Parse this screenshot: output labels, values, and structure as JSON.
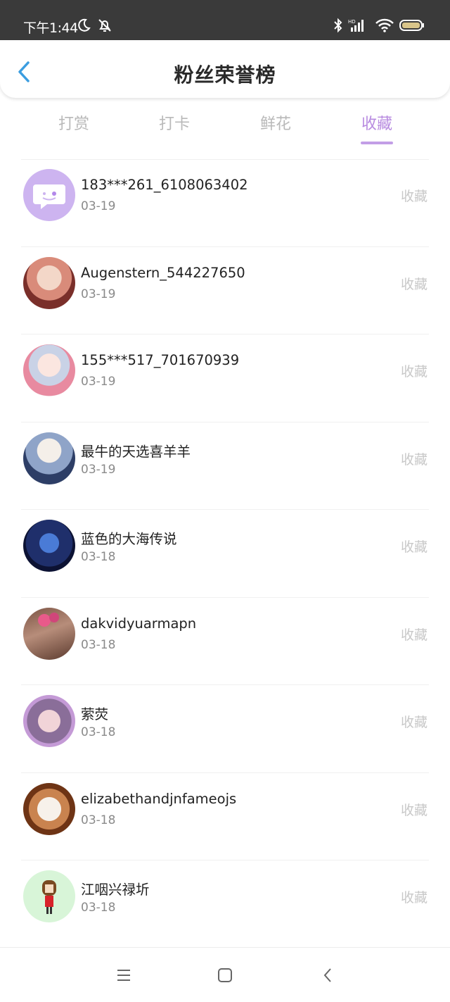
{
  "status_bar": {
    "time": "下午1:44",
    "icons": [
      "moon-icon",
      "bell-off-icon",
      "bluetooth-icon",
      "hd-signal-icon",
      "wifi-icon",
      "battery-icon"
    ]
  },
  "header": {
    "title": "粉丝荣誉榜",
    "back_icon": "chevron-left-icon"
  },
  "tabs": [
    {
      "label": "打赏",
      "active": false
    },
    {
      "label": "打卡",
      "active": false
    },
    {
      "label": "鲜花",
      "active": false
    },
    {
      "label": "收藏",
      "active": true
    }
  ],
  "fans": [
    {
      "name": "183***261_6108063402",
      "date": "03-19",
      "action": "收藏",
      "avatar": "default-chat-avatar"
    },
    {
      "name": "Augenstern_544227650",
      "date": "03-19",
      "action": "收藏",
      "avatar": "anime-girl-avatar"
    },
    {
      "name": "155***517_701670939",
      "date": "03-19",
      "action": "收藏",
      "avatar": "anime-girl-kimono-avatar"
    },
    {
      "name": "最牛的天选喜羊羊",
      "date": "03-19",
      "action": "收藏",
      "avatar": "anime-boy-avatar"
    },
    {
      "name": "蓝色的大海传说",
      "date": "03-18",
      "action": "收藏",
      "avatar": "dark-character-avatar"
    },
    {
      "name": "dakvidyuarmapn",
      "date": "03-18",
      "action": "收藏",
      "avatar": "balloons-photo-avatar"
    },
    {
      "name": "萦荧",
      "date": "03-18",
      "action": "收藏",
      "avatar": "girl-photo-avatar"
    },
    {
      "name": "elizabethandjnfameojs",
      "date": "03-18",
      "action": "收藏",
      "avatar": "latte-art-avatar"
    },
    {
      "name": "江咽兴禄圻",
      "date": "03-18",
      "action": "收藏",
      "avatar": "pixel-girl-avatar"
    }
  ],
  "nav_bar": [
    "menu-icon",
    "home-square-icon",
    "back-triangle-icon"
  ],
  "colors": {
    "accent": "#b88be0",
    "back_arrow": "#3b9de0",
    "muted": "#c8c8c8"
  }
}
